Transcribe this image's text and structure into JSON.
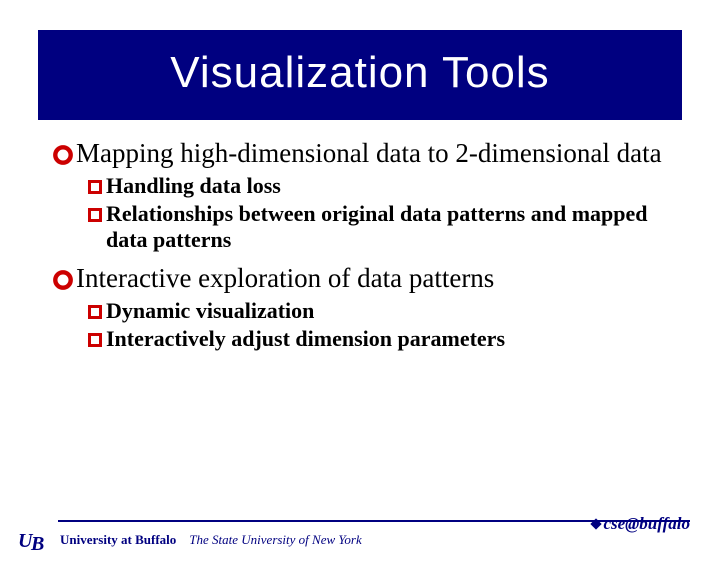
{
  "title": "Visualization Tools",
  "bullets": [
    {
      "text": "Mapping high-dimensional data to 2-dimensional data",
      "children": [
        "Handling data loss",
        "Relationships between original data patterns and mapped data patterns"
      ]
    },
    {
      "text": "Interactive exploration of data patterns",
      "children": [
        "Dynamic visualization",
        "Interactively adjust dimension parameters"
      ]
    }
  ],
  "footer": {
    "university": "University at Buffalo",
    "tagline": "The State University of New York",
    "dept": "cse@buffalo"
  },
  "colors": {
    "navy": "#000080",
    "red": "#cc0000"
  }
}
